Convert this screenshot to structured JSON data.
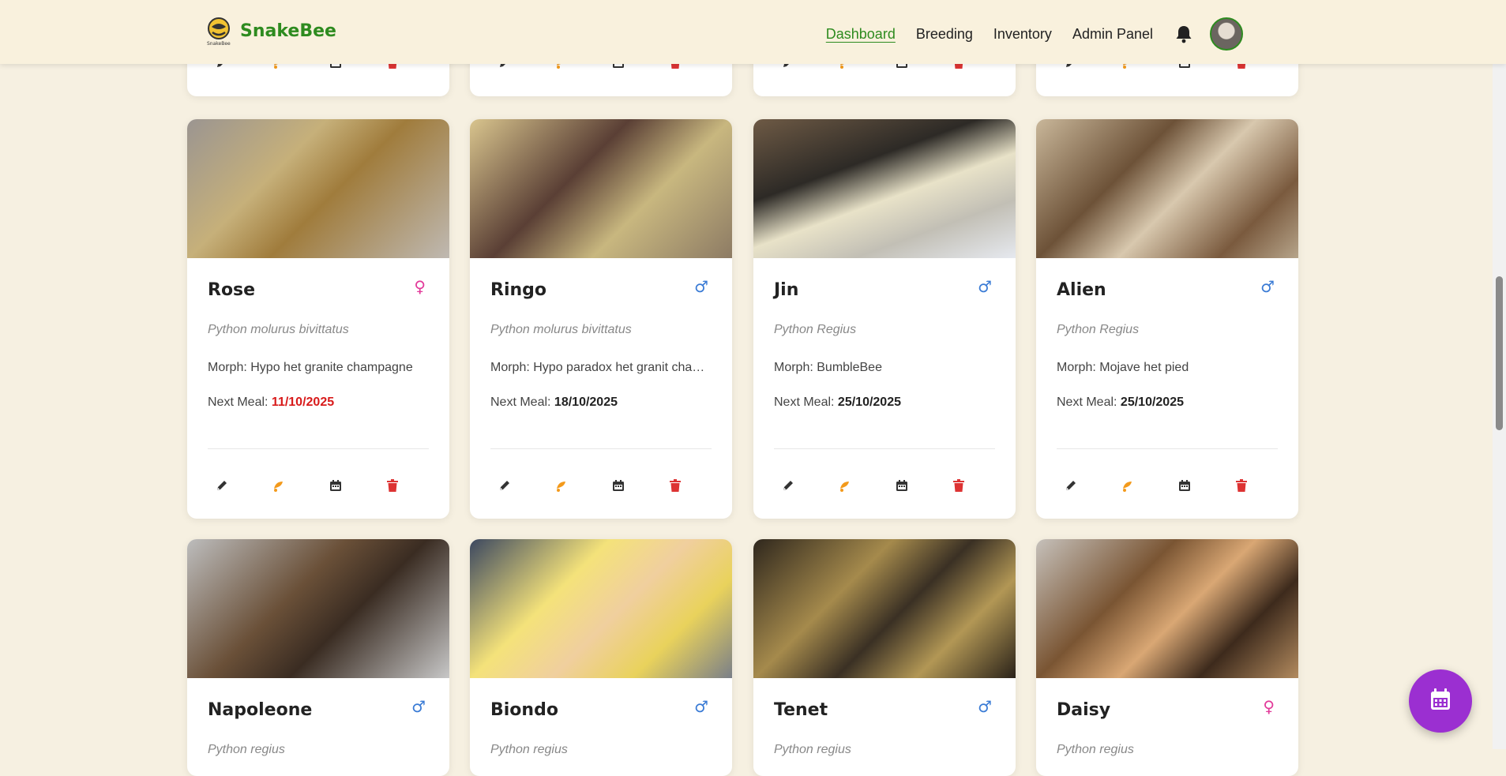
{
  "brand": {
    "name": "SnakeBee"
  },
  "nav": {
    "links": [
      "Dashboard",
      "Breeding",
      "Inventory",
      "Admin Panel"
    ],
    "active": "Dashboard"
  },
  "icons": {
    "bell": "bell-icon",
    "edit": "pencil-icon",
    "feed": "feeding-icon",
    "calendar": "calendar-icon",
    "delete": "trash-icon",
    "fab": "calendar-icon"
  },
  "colors": {
    "brand_green": "#2e8b1f",
    "overdue_red": "#d81b1b",
    "male_blue": "#3a7bd5",
    "female_pink": "#e23a9a",
    "fab_purple": "#9b2fd1"
  },
  "labels": {
    "morph_prefix": "Morph: ",
    "next_meal_prefix": "Next Meal: "
  },
  "snakes": [
    {
      "name": "Rose",
      "sex": "female",
      "sex_symbol": "♀",
      "species": "Python molurus bivittatus",
      "morph": "Hypo het granite champagne",
      "next_meal": "11/10/2025",
      "overdue": true
    },
    {
      "name": "Ringo",
      "sex": "male",
      "sex_symbol": "♂",
      "species": "Python molurus bivittatus",
      "morph": "Hypo paradox het granit champagne",
      "next_meal": "18/10/2025",
      "overdue": false
    },
    {
      "name": "Jin",
      "sex": "male",
      "sex_symbol": "♂",
      "species": "Python Regius",
      "morph": "BumbleBee",
      "next_meal": "25/10/2025",
      "overdue": false
    },
    {
      "name": "Alien",
      "sex": "male",
      "sex_symbol": "♂",
      "species": "Python Regius",
      "morph": "Mojave het pied",
      "next_meal": "25/10/2025",
      "overdue": false
    },
    {
      "name": "Napoleone",
      "sex": "male",
      "sex_symbol": "♂",
      "species": "Python regius"
    },
    {
      "name": "Biondo",
      "sex": "male",
      "sex_symbol": "♂",
      "species": "Python regius"
    },
    {
      "name": "Tenet",
      "sex": "male",
      "sex_symbol": "♂",
      "species": "Python regius"
    },
    {
      "name": "Daisy",
      "sex": "female",
      "sex_symbol": "♀",
      "species": "Python regius"
    }
  ]
}
